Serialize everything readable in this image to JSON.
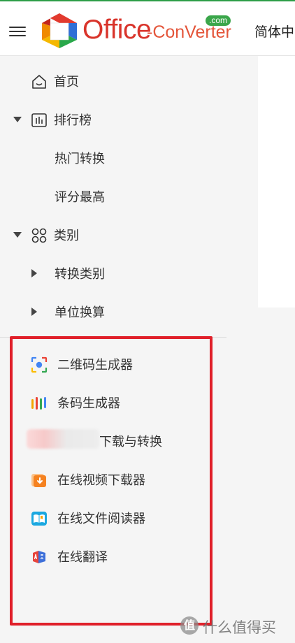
{
  "header": {
    "logo_office": "Office",
    "logo_converter": "-ConVerter",
    "logo_com": ".com",
    "language": "简体中"
  },
  "colors": {
    "accent_green": "#2e9e48",
    "logo_red": "#d9342b",
    "highlight_red": "#e0202a"
  },
  "sidebar": {
    "items": [
      {
        "label": "首页",
        "icon": "home-icon"
      },
      {
        "label": "排行榜",
        "icon": "bar-chart-icon",
        "expanded": true
      },
      {
        "label": "热门转换"
      },
      {
        "label": "评分最高"
      },
      {
        "label": "类别",
        "icon": "grid-icon",
        "expanded": true
      },
      {
        "label": "转换类别",
        "expanded": false
      },
      {
        "label": "单位换算",
        "expanded": false
      }
    ]
  },
  "tools": {
    "items": [
      {
        "label": "二维码生成器",
        "icon": "qr-scan-icon"
      },
      {
        "label": "条码生成器",
        "icon": "barcode-icon"
      },
      {
        "label": "下载与转换",
        "icon": "blurred-icon"
      },
      {
        "label": "在线视频下载器",
        "icon": "video-download-icon"
      },
      {
        "label": "在线文件阅读器",
        "icon": "book-reader-icon"
      },
      {
        "label": "在线翻译",
        "icon": "translate-icon"
      }
    ]
  },
  "watermark": {
    "badge": "值",
    "text": "什么值得买"
  }
}
